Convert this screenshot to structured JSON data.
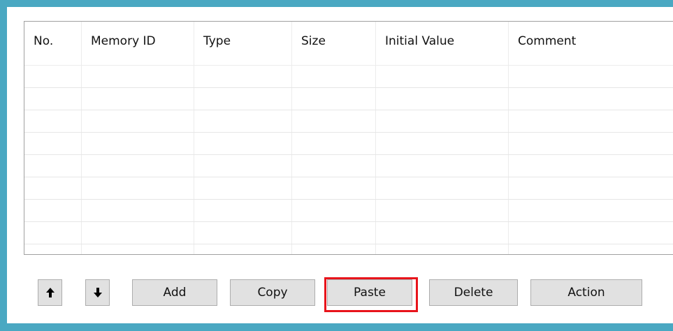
{
  "table": {
    "columns": [
      "No.",
      "Memory ID",
      "Type",
      "Size",
      "Initial Value",
      "Comment"
    ],
    "rows": []
  },
  "toolbar": {
    "move_up_icon": "arrow-up-icon",
    "move_down_icon": "arrow-down-icon",
    "add_label": "Add",
    "copy_label": "Copy",
    "paste_label": "Paste",
    "delete_label": "Delete",
    "action_label": "Action"
  },
  "colors": {
    "frame": "#4aa8c2",
    "highlight": "#e8141b",
    "button_bg": "#e1e1e1"
  }
}
